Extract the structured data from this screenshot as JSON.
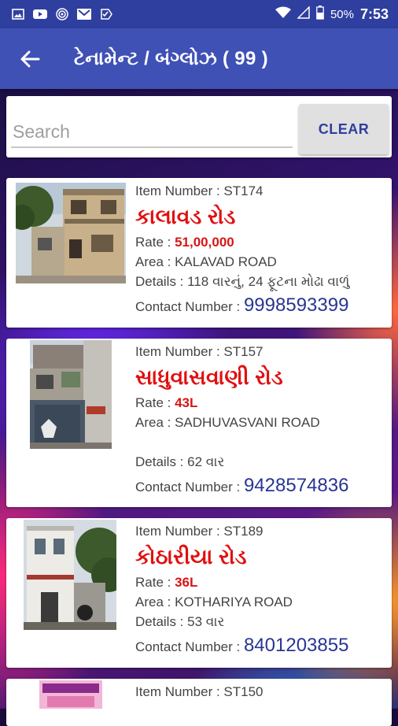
{
  "status_bar": {
    "battery": "50%",
    "time": "7:53"
  },
  "app_bar": {
    "title": "ટેનામેન્ટ / બંગ્લોઝ ( 99 )"
  },
  "search": {
    "placeholder": "Search",
    "value": "",
    "clear_label": "CLEAR"
  },
  "listings": [
    {
      "item_label": "Item Number : ST174",
      "location_gu": "કાલાવડ રોડ",
      "rate_label": "Rate : ",
      "rate_value": "51,00,000",
      "area_label": "Area : KALAVAD ROAD",
      "details_label": "Details : 118 વારનું, 24 ફૂટના મોઢા વાળું",
      "contact_label": "Contact Number : ",
      "contact_value": "9998593399"
    },
    {
      "item_label": "Item Number : ST157",
      "location_gu": "સાધુવાસવાણી રોડ",
      "rate_label": "Rate : ",
      "rate_value": "43L",
      "area_label": "Area : SADHUVASVANI ROAD",
      "details_label": "Details : 62 વાર",
      "contact_label": "Contact Number : ",
      "contact_value": "9428574836"
    },
    {
      "item_label": "Item Number : ST189",
      "location_gu": "કોઠારીયા રોડ",
      "rate_label": "Rate : ",
      "rate_value": "36L",
      "area_label": "Area : KOTHARIYA ROAD",
      "details_label": "Details : 53 વાર",
      "contact_label": "Contact Number : ",
      "contact_value": "8401203855"
    },
    {
      "item_label": "Item Number : ST150"
    }
  ]
}
